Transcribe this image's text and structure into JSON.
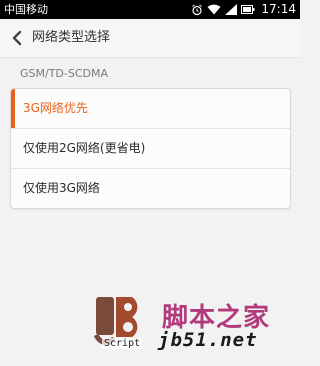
{
  "status_bar": {
    "carrier": "中国移动",
    "time": "17:14",
    "icons": [
      "alarm-icon",
      "wifi-icon",
      "signal-icon",
      "battery-icon"
    ]
  },
  "header": {
    "back_icon": "chevron-left-icon",
    "title": "网络类型选择"
  },
  "section": {
    "label": "GSM/TD-SCDMA"
  },
  "options": [
    {
      "label": "3G网络优先",
      "selected": true
    },
    {
      "label": "仅使用2G网络(更省电)",
      "selected": false
    },
    {
      "label": "仅使用3G网络",
      "selected": false
    }
  ],
  "watermark": {
    "logo_text": "jb",
    "script_label": "Script",
    "brand_cn": "脚本之家",
    "url": "jb51.net"
  },
  "colors": {
    "accent": "#e8621a",
    "status_bar_bg": "#000000",
    "page_bg": "#f2f2f2"
  }
}
